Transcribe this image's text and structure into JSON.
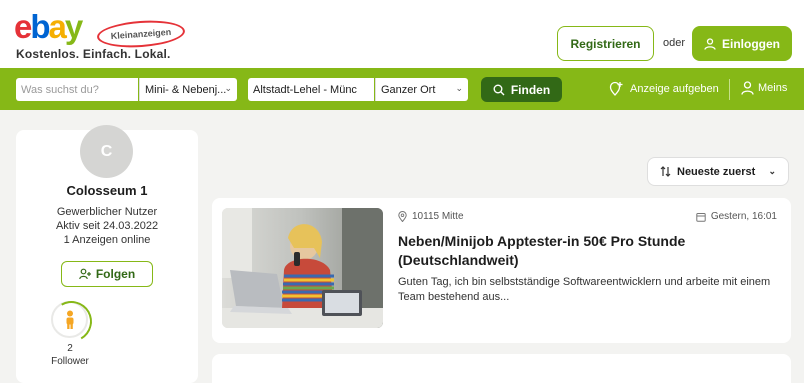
{
  "header": {
    "logo_text": "ebay",
    "logo_badge": "Kleinanzeigen",
    "tagline": "Kostenlos. Einfach. Lokal.",
    "register_label": "Registrieren",
    "or_label": "oder",
    "login_label": "Einloggen"
  },
  "search": {
    "query_placeholder": "Was suchst du?",
    "category_value": "Mini- & Nebenj...",
    "location_value": "Altstadt-Lehel - Münc",
    "radius_value": "Ganzer Ort",
    "find_label": "Finden",
    "post_ad_label": "Anzeige aufgeben",
    "account_label": "Meins"
  },
  "profile": {
    "avatar_initial": "C",
    "name": "Colosseum 1",
    "user_type": "Gewerblicher Nutzer",
    "active_since": "Aktiv seit 24.03.2022",
    "ads_online": "1 Anzeigen online",
    "follow_label": "Folgen",
    "follower_count": "2",
    "follower_label": "Follower"
  },
  "sort": {
    "label": "Neueste zuerst"
  },
  "listing": {
    "location": "10115 Mitte",
    "date": "Gestern, 16:01",
    "title": "Neben/Minijob Apptester-in 50€ Pro Stunde (Deutschlandweit)",
    "description": "Guten Tag, ich bin selbstständige Softwareentwicklern und arbeite mit einem Team bestehend aus..."
  },
  "colors": {
    "brand_green": "#86b817",
    "dark_green": "#326916",
    "background": "#f3f3f1"
  }
}
